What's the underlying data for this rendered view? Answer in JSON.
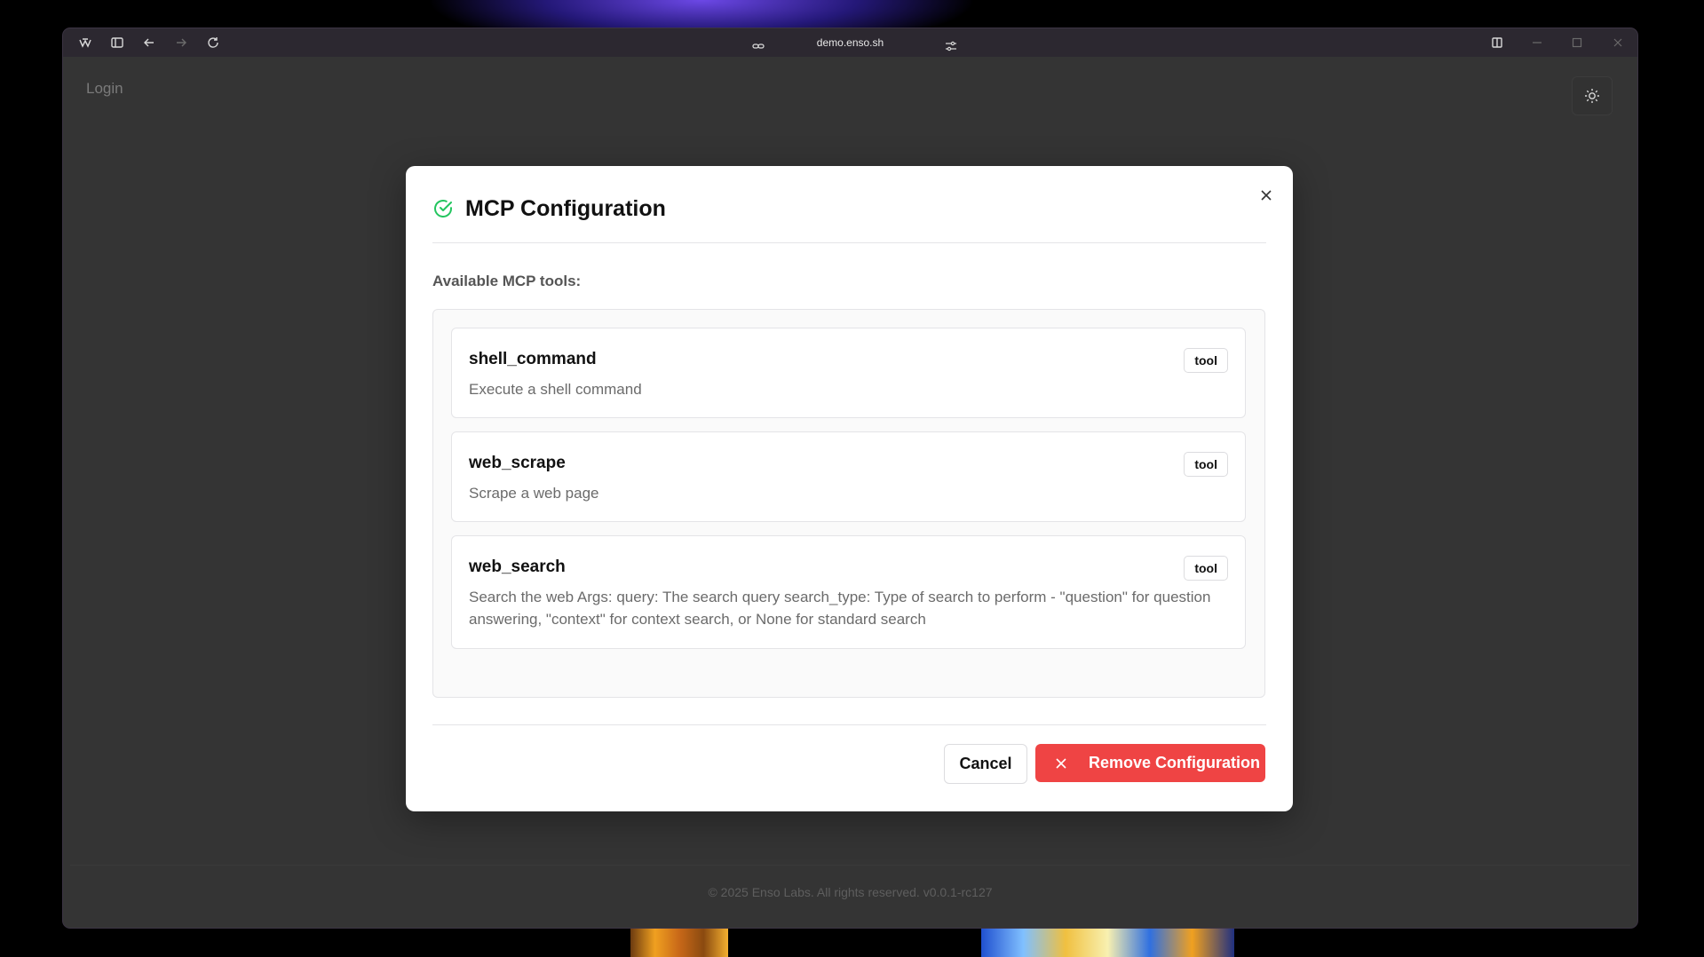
{
  "browser": {
    "url": "demo.enso.sh",
    "icons": {
      "app": "app-logo-icon",
      "sidebar": "sidebar-toggle-icon",
      "back": "back-arrow-icon",
      "forward": "forward-arrow-icon",
      "reload": "reload-icon",
      "link": "link-icon",
      "settings": "tune-icon",
      "split": "split-view-icon",
      "minimize": "minimize-icon",
      "maximize": "maximize-icon",
      "close": "close-window-icon"
    }
  },
  "page": {
    "title": "Login",
    "theme_icon": "sun-icon",
    "footer": "© 2025 Enso Labs. All rights reserved. v0.0.1-rc127"
  },
  "modal": {
    "title": "MCP Configuration",
    "status_icon": "check-circle-icon",
    "status_color": "#22c55e",
    "section_label": "Available MCP tools:",
    "tools": [
      {
        "name": "shell_command",
        "description": "Execute a shell command",
        "badge": "tool"
      },
      {
        "name": "web_scrape",
        "description": "Scrape a web page",
        "badge": "tool"
      },
      {
        "name": "web_search",
        "description": "Search the web Args: query: The search query search_type: Type of search to perform - \"question\" for question answering, \"context\" for context search, or None for standard search",
        "badge": "tool"
      }
    ],
    "cancel_label": "Cancel",
    "remove_label": "Remove Configuration",
    "remove_color": "#ef4444"
  }
}
